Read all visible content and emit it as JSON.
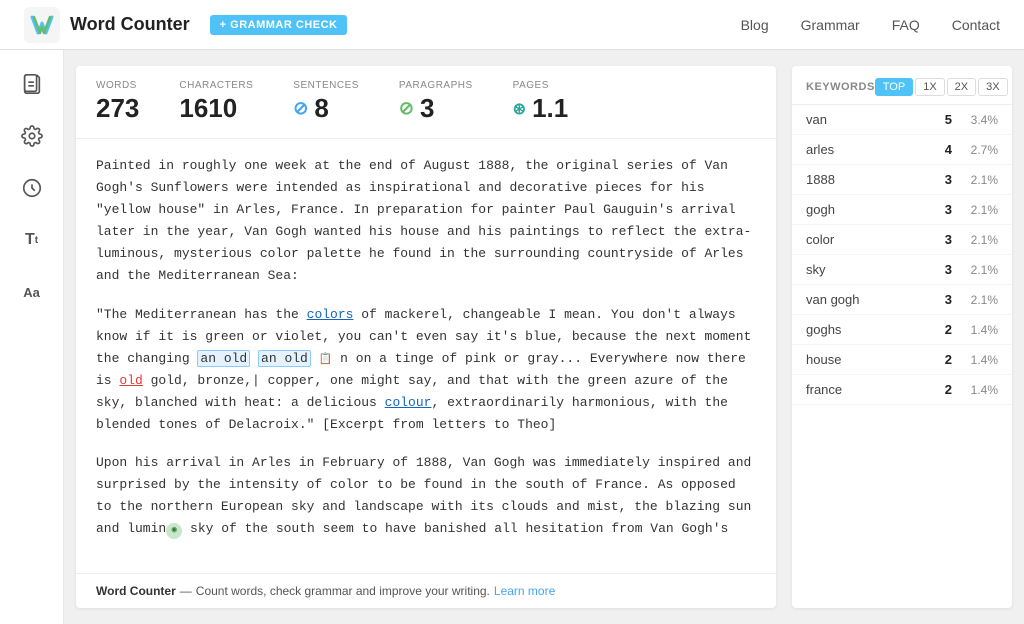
{
  "header": {
    "app_title": "Word Counter",
    "grammar_check_label": "+ GRAMMAR CHECK",
    "nav_items": [
      "Blog",
      "Grammar",
      "FAQ",
      "Contact"
    ]
  },
  "stats": {
    "words_label": "WORDS",
    "words_value": "273",
    "characters_label": "CHARACTERS",
    "characters_value": "1610",
    "sentences_label": "SENTENCES",
    "sentences_value": "8",
    "paragraphs_label": "PARAGRAPHS",
    "paragraphs_value": "3",
    "pages_label": "PAGES",
    "pages_value": "1.1"
  },
  "text": {
    "paragraph1": "Painted in roughly one week at the end of August 1888, the original series of Van Gogh's Sunflowers were intended as inspirational and decorative pieces for his \"yellow house\" in Arles, France. In preparation for painter Paul Gauguin's arrival later in the year, Van Gogh wanted his house and his paintings to reflect the extra-luminous, mysterious color palette he found in the surrounding countryside of Arles and the Mediterranean Sea:",
    "paragraph2": "\"The Mediterranean has the colors of mackerel, changeable I mean. You don't always know if it is green or violet, you can't even say it's blue, because the next moment the changing  n on a tinge of pink or gray... Everywhere now there is old gold, bronze, copper, one might say, and that with the green azure of the sky, blanched with heat: a delicious colour, extraordinarily harmonious, with the blended tones of Delacroix.\" [Excerpt from letters to Theo]",
    "paragraph3": "Upon his arrival in Arles in February of 1888, Van Gogh was immediately inspired and surprised by the intensity of color to be found in the south of France. As opposed to the northern European sky and landscape with its clouds and mist, the blazing sun and luminous sky of the south seem to have banished all hesitation from Van Gogh's"
  },
  "footer": {
    "bold_text": "Word Counter",
    "dash": "—",
    "description": "Count words, check grammar and improve your writing.",
    "link_text": "Learn more"
  },
  "keywords": {
    "title": "KEYWORDS",
    "tabs": [
      "TOP",
      "1X",
      "2X",
      "3X"
    ],
    "active_tab": "TOP",
    "rows": [
      {
        "word": "van",
        "count": "5",
        "pct": "3.4%"
      },
      {
        "word": "arles",
        "count": "4",
        "pct": "2.7%"
      },
      {
        "word": "1888",
        "count": "3",
        "pct": "2.1%"
      },
      {
        "word": "gogh",
        "count": "3",
        "pct": "2.1%"
      },
      {
        "word": "color",
        "count": "3",
        "pct": "2.1%"
      },
      {
        "word": "sky",
        "count": "3",
        "pct": "2.1%"
      },
      {
        "word": "van gogh",
        "count": "3",
        "pct": "2.1%"
      },
      {
        "word": "goghs",
        "count": "2",
        "pct": "1.4%"
      },
      {
        "word": "house",
        "count": "2",
        "pct": "1.4%"
      },
      {
        "word": "france",
        "count": "2",
        "pct": "1.4%"
      }
    ]
  },
  "sidebar_icons": [
    {
      "name": "document-icon",
      "symbol": "📄"
    },
    {
      "name": "settings-icon",
      "symbol": "⚙"
    },
    {
      "name": "circle-icon",
      "symbol": "○"
    },
    {
      "name": "font-size-icon",
      "symbol": "T"
    },
    {
      "name": "font-aa-icon",
      "symbol": "Aa"
    }
  ]
}
